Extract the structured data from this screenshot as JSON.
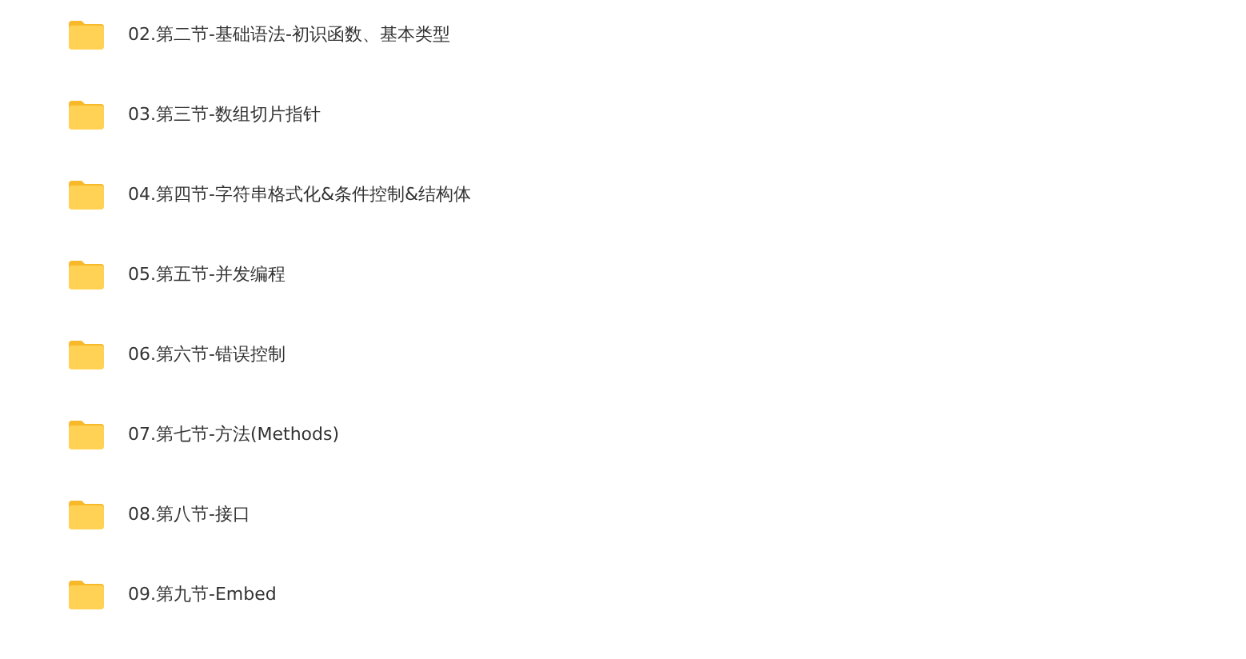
{
  "folders": [
    {
      "name": "02.第二节-基础语法-初识函数、基本类型"
    },
    {
      "name": "03.第三节-数组切片指针"
    },
    {
      "name": "04.第四节-字符串格式化&条件控制&结构体"
    },
    {
      "name": "05.第五节-并发编程"
    },
    {
      "name": "06.第六节-错误控制"
    },
    {
      "name": "07.第七节-方法(Methods)"
    },
    {
      "name": "08.第八节-接口"
    },
    {
      "name": "09.第九节-Embed"
    }
  ]
}
